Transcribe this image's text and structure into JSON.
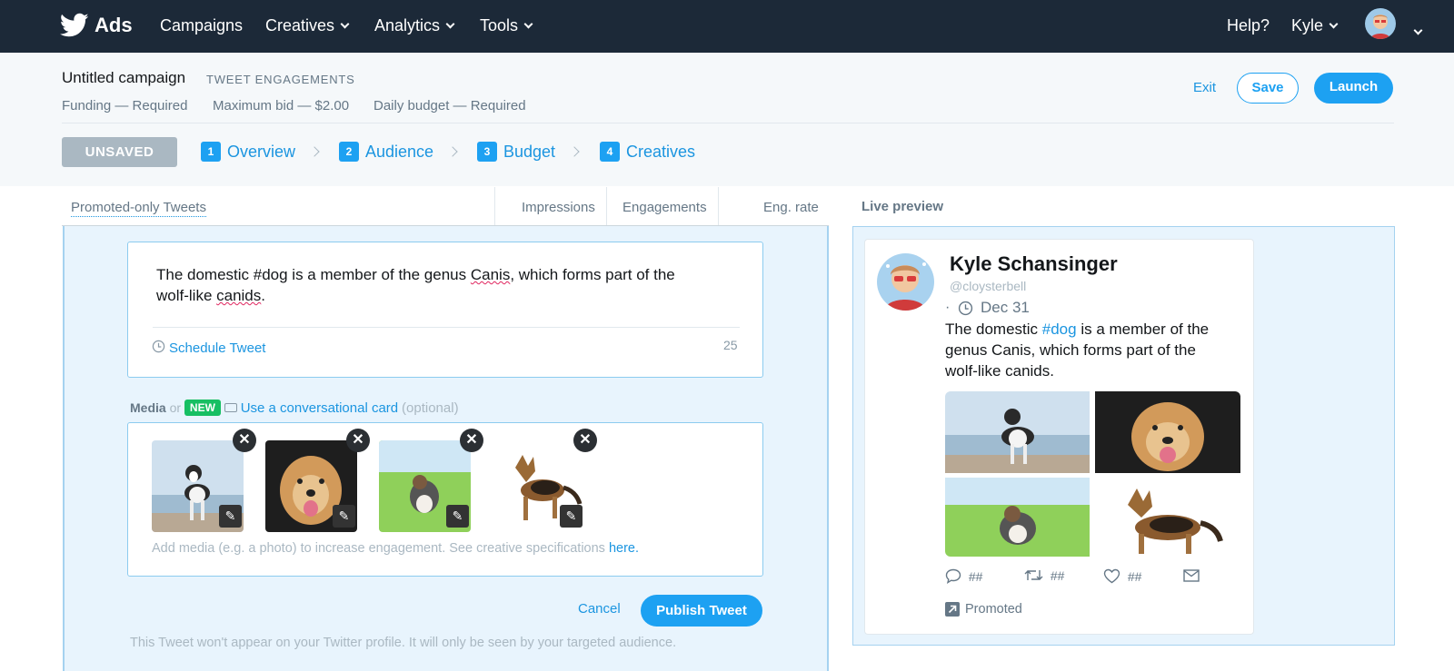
{
  "nav": {
    "brand": "Ads",
    "items": [
      "Campaigns",
      "Creatives",
      "Analytics",
      "Tools"
    ],
    "help": "Help?",
    "user": "Kyle"
  },
  "campaign": {
    "title": "Untitled campaign",
    "objective": "TWEET ENGAGEMENTS",
    "funding": "Funding — Required",
    "max_bid": "Maximum bid — $2.00",
    "daily_budget": "Daily budget — Required",
    "exit": "Exit",
    "save": "Save",
    "launch": "Launch",
    "status": "UNSAVED",
    "steps": [
      {
        "num": "1",
        "label": "Overview"
      },
      {
        "num": "2",
        "label": "Audience"
      },
      {
        "num": "3",
        "label": "Budget"
      },
      {
        "num": "4",
        "label": "Creatives"
      }
    ]
  },
  "table": {
    "filter": "Promoted-only Tweets",
    "col_impressions": "Impressions",
    "col_engagements": "Engagements",
    "col_eng_rate": "Eng. rate"
  },
  "composer": {
    "text_pre": "The domestic #dog is a member of the genus ",
    "text_canis": "Canis",
    "text_mid": ", which forms part of the",
    "text_line2_pre": "wolf-like ",
    "text_canids": "canids",
    "text_end": ".",
    "schedule": "Schedule Tweet",
    "char_count": "25",
    "media_label": "Media",
    "or": "or",
    "new_badge": "NEW",
    "card_link": "Use a conversational card",
    "optional": "(optional)",
    "media_hint": "Add media (e.g. a photo) to increase engagement. See creative specifications",
    "media_hint_link": "here.",
    "cancel": "Cancel",
    "publish": "Publish Tweet",
    "footer_note": "This Tweet won't appear on your Twitter profile. It will only be seen by your targeted audience."
  },
  "preview": {
    "header": "Live preview",
    "name": "Kyle Schansinger",
    "handle": "@cloysterbell",
    "dot": "·",
    "date": "Dec 31",
    "text_pre": "The domestic ",
    "hashtag": "#dog",
    "text_post": " is a member of the genus Canis, which forms part of the wolf-like canids.",
    "reply_count": "##",
    "retweet_count": "##",
    "like_count": "##",
    "promoted": "Promoted"
  },
  "colors": {
    "nav_bg": "#1c2938",
    "accent": "#1da1f2",
    "link": "#1b95e0",
    "new_badge": "#17bf63",
    "unsaved_bg": "#aab8c2",
    "panel_bg": "#e8f4fd"
  }
}
